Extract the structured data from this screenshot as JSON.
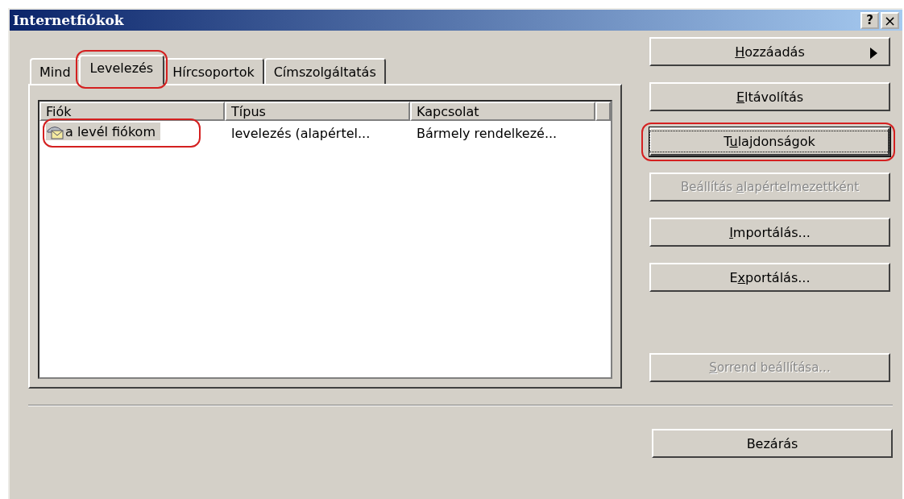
{
  "window": {
    "title": "Internetfiókok",
    "title_buttons": [
      {
        "kind": "help",
        "label": "?"
      },
      {
        "kind": "close",
        "label": "×"
      }
    ]
  },
  "tabs": [
    {
      "label": "Mind",
      "selected": false,
      "annotated": false
    },
    {
      "label": "Levelezés",
      "selected": true,
      "annotated": true
    },
    {
      "label": "Hírcsoportok",
      "selected": false,
      "annotated": false
    },
    {
      "label": "Címszolgáltatás",
      "selected": false,
      "annotated": false
    }
  ],
  "list": {
    "columns": [
      "Fiók",
      "Típus",
      "Kapcsolat"
    ],
    "rows": [
      {
        "cells": [
          "a levél fiókom",
          "levelezés (alapértel...",
          "Bármely rendelkezé..."
        ],
        "selected": true,
        "annotated": true
      }
    ]
  },
  "buttons": [
    {
      "label": {
        "key": "H",
        "after": "ozzáadás"
      },
      "kind": "menu",
      "disabled": false,
      "focused": false,
      "annotated": false
    },
    {
      "label": {
        "key": "E",
        "after": "ltávolítás"
      },
      "kind": "plain",
      "disabled": false,
      "focused": false,
      "annotated": false
    },
    {
      "label": {
        "before": "T",
        "key": "u",
        "after": "lajdonságok"
      },
      "kind": "plain",
      "disabled": false,
      "focused": true,
      "annotated": true
    },
    {
      "label": {
        "before": "Beállítás ",
        "key": "a",
        "after": "lapértelmezettként"
      },
      "kind": "plain",
      "disabled": true,
      "focused": false,
      "annotated": false
    },
    {
      "label": {
        "key": "I",
        "after": "mportálás..."
      },
      "kind": "plain",
      "disabled": false,
      "focused": false,
      "annotated": false
    },
    {
      "label": {
        "before": "E",
        "key": "x",
        "after": "portálás..."
      },
      "kind": "plain",
      "disabled": false,
      "focused": false,
      "annotated": false
    },
    {
      "label": {
        "key": "S",
        "after": "orrend beállítása..."
      },
      "kind": "bottom",
      "disabled": true,
      "focused": false,
      "annotated": false
    }
  ],
  "close_button": {
    "label": "Bezárás"
  }
}
